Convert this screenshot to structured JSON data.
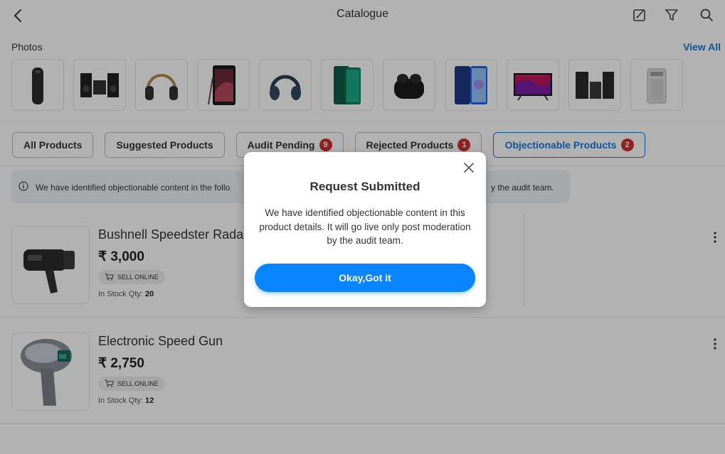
{
  "header": {
    "title": "Catalogue",
    "icons": [
      "back-arrow-icon",
      "edit-icon",
      "filter-icon",
      "search-icon"
    ]
  },
  "photos": {
    "label": "Photos",
    "view_all": "View All",
    "items": [
      "air-purifier",
      "speaker-system",
      "headphones",
      "smartphone",
      "headphones",
      "smartphone",
      "earbuds",
      "smartphone",
      "television",
      "speaker-system",
      "air-purifier"
    ]
  },
  "tabs": [
    {
      "label": "All Products",
      "badge": ""
    },
    {
      "label": "Suggested Products",
      "badge": ""
    },
    {
      "label": "Audit Pending",
      "badge": "9"
    },
    {
      "label": "Rejected Products",
      "badge": "1"
    },
    {
      "label": "Objectionable Products",
      "badge": "2"
    }
  ],
  "banner": {
    "text_left": "We have identified objectionable content in the follo",
    "text_right": "y the audit team."
  },
  "products": [
    {
      "name": "Bushnell Speedster Rada",
      "price": "₹ 3,000",
      "sell_label": "SELL ONLINE",
      "stock_label": "In Stock Qty:",
      "stock_qty": "20"
    },
    {
      "name": "Electronic Speed Gun",
      "price": "₹ 2,750",
      "sell_label": "SELL ONLINE",
      "stock_label": "In Stock Qty:",
      "stock_qty": "12"
    }
  ],
  "modal": {
    "title": "Request Submitted",
    "message": "We have identified objectionable content in this product details. It will go live only post moderation by the audit team.",
    "button_label": "Okay,Got it"
  },
  "colors": {
    "accent": "#1677d9",
    "button": "#0a84ff",
    "badge": "#d32f2f"
  }
}
